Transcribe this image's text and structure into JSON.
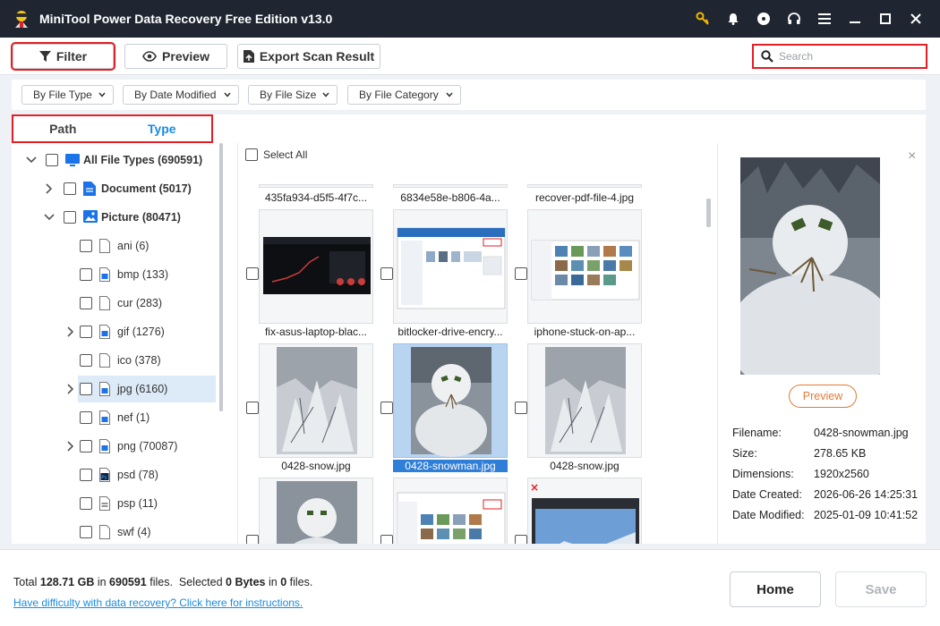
{
  "app": {
    "title": "MiniTool Power Data Recovery Free Edition v13.0"
  },
  "toolbar": {
    "filter_label": "Filter",
    "preview_label": "Preview",
    "export_label": "Export Scan Result",
    "search_placeholder": "Search"
  },
  "filters": [
    "By File Type",
    "By Date Modified",
    "By File Size",
    "By File Category"
  ],
  "tabs": {
    "path": "Path",
    "type": "Type"
  },
  "tree": [
    {
      "label": "All File Types",
      "count": "(690591)",
      "icon": "monitor-icon",
      "expanded": true,
      "level": 0
    },
    {
      "label": "Document",
      "count": "(5017)",
      "icon": "document-icon",
      "expanded": false,
      "level": 1
    },
    {
      "label": "Picture",
      "count": "(80471)",
      "icon": "picture-icon",
      "expanded": true,
      "level": 1
    },
    {
      "label": "ani",
      "count": "(6)",
      "icon": "file-icon",
      "level": 2
    },
    {
      "label": "bmp",
      "count": "(133)",
      "icon": "image-file-icon",
      "level": 2
    },
    {
      "label": "cur",
      "count": "(283)",
      "icon": "file-icon",
      "level": 2
    },
    {
      "label": "gif",
      "count": "(1276)",
      "icon": "image-file-icon",
      "level": 2,
      "expandable": true
    },
    {
      "label": "ico",
      "count": "(378)",
      "icon": "file-icon",
      "level": 2
    },
    {
      "label": "jpg",
      "count": "(6160)",
      "icon": "image-file-icon",
      "level": 2,
      "expandable": true,
      "selected": true
    },
    {
      "label": "nef",
      "count": "(1)",
      "icon": "image-file-icon",
      "level": 2
    },
    {
      "label": "png",
      "count": "(70087)",
      "icon": "image-file-icon",
      "level": 2,
      "expandable": true
    },
    {
      "label": "psd",
      "count": "(78)",
      "icon": "photoshop-icon",
      "level": 2
    },
    {
      "label": "psp",
      "count": "(11)",
      "icon": "psp-file-icon",
      "level": 2
    },
    {
      "label": "swf",
      "count": "(4)",
      "icon": "file-icon",
      "level": 2
    }
  ],
  "grid": {
    "select_all": "Select All",
    "top_captions": [
      "435fa934-d5f5-4f7c...",
      "6834e58e-b806-4a...",
      "recover-pdf-file-4.jpg"
    ],
    "row1_captions": [
      "fix-asus-laptop-blac...",
      "bitlocker-drive-encry...",
      "iphone-stuck-on-ap..."
    ],
    "row2_captions": [
      "0428-snow.jpg",
      "0428-snowman.jpg",
      "0428-snow.jpg"
    ]
  },
  "preview": {
    "button": "Preview",
    "rows": [
      {
        "key": "Filename:",
        "value": "0428-snowman.jpg"
      },
      {
        "key": "Size:",
        "value": "278.65 KB"
      },
      {
        "key": "Dimensions:",
        "value": "1920x2560"
      },
      {
        "key": "Date Created:",
        "value": "2026-06-26 14:25:31"
      },
      {
        "key": "Date Modified:",
        "value": "2025-01-09 10:41:52"
      }
    ]
  },
  "footer": {
    "total_prefix": "Total ",
    "total_size": "128.71 GB",
    "in1": " in ",
    "total_files": "690591",
    "files1": " files.  Selected ",
    "selected_size": "0 Bytes",
    "in2": " in ",
    "selected_files": "0",
    "files2": " files.",
    "help_link": "Have difficulty with data recovery? Click here for instructions.",
    "home_label": "Home",
    "save_label": "Save"
  }
}
